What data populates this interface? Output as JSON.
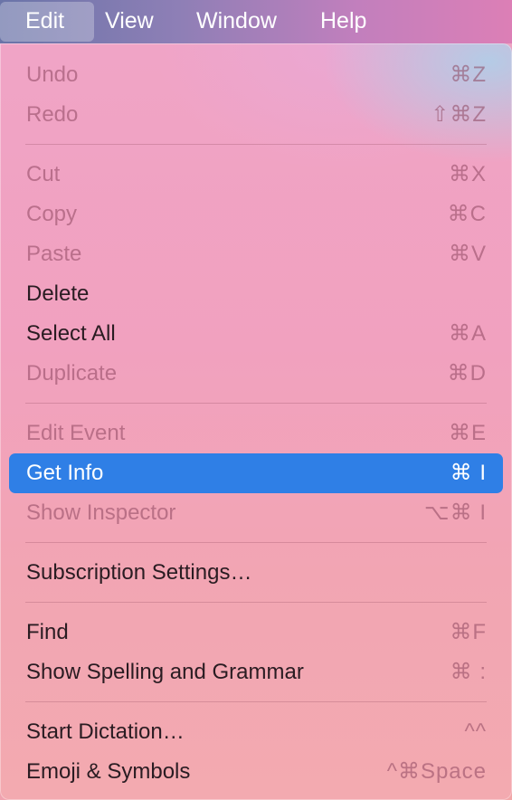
{
  "menubar": {
    "items": [
      {
        "label": "Edit",
        "active": true
      },
      {
        "label": "View",
        "active": false
      },
      {
        "label": "Window",
        "active": false
      },
      {
        "label": "Help",
        "active": false
      }
    ]
  },
  "menu": {
    "undo": {
      "label": "Undo",
      "shortcut": "⌘Z",
      "enabled": false
    },
    "redo": {
      "label": "Redo",
      "shortcut": "⇧⌘Z",
      "enabled": false
    },
    "cut": {
      "label": "Cut",
      "shortcut": "⌘X",
      "enabled": false
    },
    "copy": {
      "label": "Copy",
      "shortcut": "⌘C",
      "enabled": false
    },
    "paste": {
      "label": "Paste",
      "shortcut": "⌘V",
      "enabled": false
    },
    "delete": {
      "label": "Delete",
      "shortcut": "",
      "enabled": true
    },
    "select_all": {
      "label": "Select All",
      "shortcut": "⌘A",
      "enabled": true
    },
    "duplicate": {
      "label": "Duplicate",
      "shortcut": "⌘D",
      "enabled": false
    },
    "edit_event": {
      "label": "Edit Event",
      "shortcut": "⌘E",
      "enabled": false
    },
    "get_info": {
      "label": "Get Info",
      "shortcut": "⌘ I",
      "enabled": true,
      "highlighted": true
    },
    "show_inspector": {
      "label": "Show Inspector",
      "shortcut": "⌥⌘ I",
      "enabled": false
    },
    "subscription_settings": {
      "label": "Subscription Settings…",
      "shortcut": "",
      "enabled": true
    },
    "find": {
      "label": "Find",
      "shortcut": "⌘F",
      "enabled": true
    },
    "show_spelling": {
      "label": "Show Spelling and Grammar",
      "shortcut": "⌘ :",
      "enabled": true
    },
    "start_dictation": {
      "label": "Start Dictation…",
      "shortcut": "^^",
      "enabled": true
    },
    "emoji_symbols": {
      "label": "Emoji & Symbols",
      "shortcut": "^⌘Space",
      "enabled": true
    }
  },
  "colors": {
    "highlight": "#2f7fe6",
    "enabled_text": "#2a1c22",
    "disabled_text": "#8c465f"
  }
}
